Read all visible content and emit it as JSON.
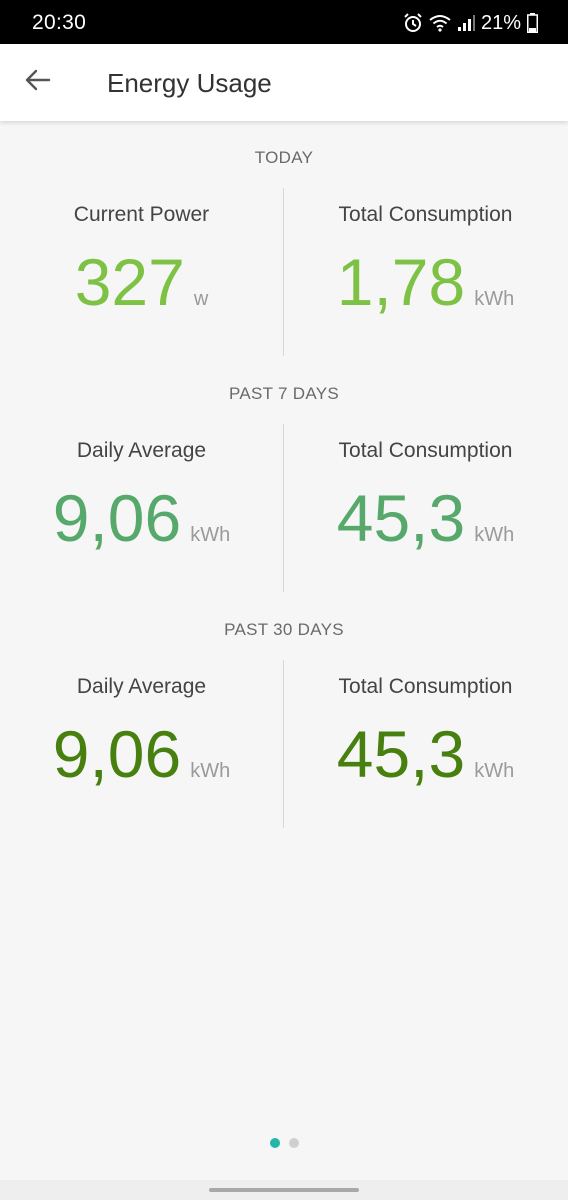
{
  "status_bar": {
    "time": "20:30",
    "battery": "21%",
    "icons": [
      "alarm-icon",
      "wifi-icon",
      "signal-icon",
      "battery-icon"
    ]
  },
  "app_bar": {
    "title": "Energy Usage",
    "back_icon": "arrow-left-icon"
  },
  "colors": {
    "today": "#7dc244",
    "past_7_days": "#56a86b",
    "past_30_days": "#47800f",
    "unit": "#9a9a9a",
    "dot_active": "#26b5a8"
  },
  "sections": [
    {
      "title": "TODAY",
      "left": {
        "label": "Current Power",
        "value": "327",
        "unit": "w"
      },
      "right": {
        "label": "Total Consumption",
        "value": "1,78",
        "unit": "kWh"
      }
    },
    {
      "title": "PAST 7 DAYS",
      "left": {
        "label": "Daily Average",
        "value": "9,06",
        "unit": "kWh"
      },
      "right": {
        "label": "Total Consumption",
        "value": "45,3",
        "unit": "kWh"
      }
    },
    {
      "title": "PAST 30 DAYS",
      "left": {
        "label": "Daily Average",
        "value": "9,06",
        "unit": "kWh"
      },
      "right": {
        "label": "Total Consumption",
        "value": "45,3",
        "unit": "kWh"
      }
    }
  ],
  "pager": {
    "page_count": 2,
    "active_page": 1
  }
}
